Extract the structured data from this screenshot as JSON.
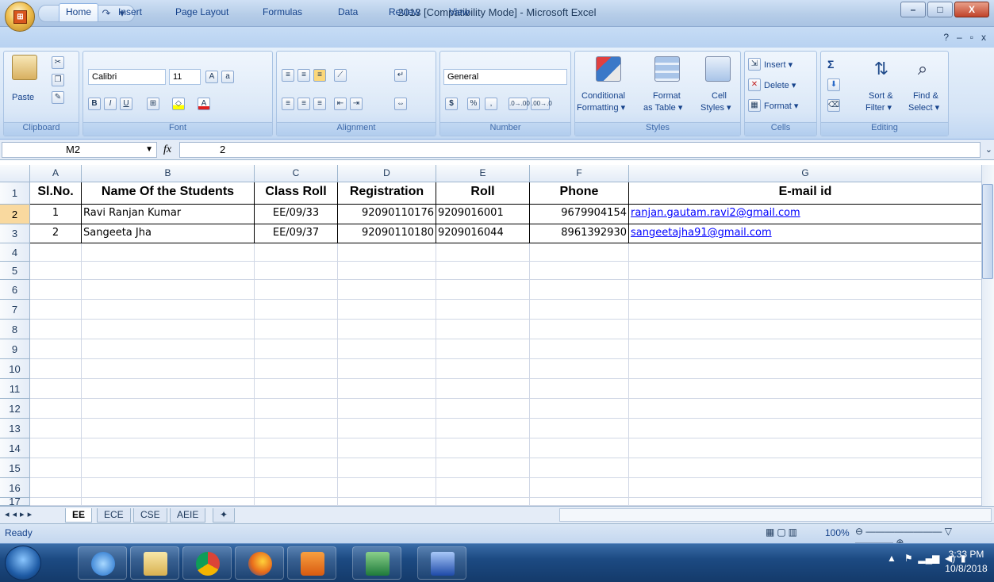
{
  "window": {
    "title": "2013  [Compatibility Mode] - Microsoft Excel",
    "minimize": "–",
    "maximize": "□",
    "close": "X"
  },
  "ribbon_tabs": [
    "Home",
    "Insert",
    "Page Layout",
    "Formulas",
    "Data",
    "Review",
    "View"
  ],
  "active_tab": "Home",
  "ribbon": {
    "clipboard": {
      "label": "Clipboard",
      "paste": "Paste"
    },
    "font": {
      "label": "Font",
      "font_name": "Calibri",
      "font_size": "11",
      "bold": "B",
      "italic": "I",
      "underline": "U"
    },
    "alignment": {
      "label": "Alignment"
    },
    "number": {
      "label": "Number",
      "format": "General",
      "currency": "$",
      "percent": "%",
      "comma": ",",
      "inc_decimal": ".0→.00",
      "dec_decimal": ".00→.0"
    },
    "styles": {
      "label": "Styles",
      "conditional": "Conditional",
      "conditional2": "Formatting ▾",
      "format_table": "Format",
      "format_table2": "as Table ▾",
      "cell_styles": "Cell",
      "cell_styles2": "Styles ▾"
    },
    "cells": {
      "label": "Cells",
      "insert": "Insert ▾",
      "delete": "Delete ▾",
      "format": "Format ▾"
    },
    "editing": {
      "label": "Editing",
      "sigma": "Σ",
      "sort_filter": "Sort &",
      "sort_filter2": "Filter ▾",
      "find_select": "Find &",
      "find_select2": "Select ▾"
    }
  },
  "formula_bar": {
    "name_box": "M2",
    "fx": "fx",
    "value": "2"
  },
  "columns": [
    "A",
    "B",
    "C",
    "D",
    "E",
    "F",
    "G"
  ],
  "rows": [
    "1",
    "2",
    "3",
    "4",
    "5",
    "6",
    "7",
    "8",
    "9",
    "10",
    "11",
    "12",
    "13",
    "14",
    "15",
    "16",
    "17"
  ],
  "table": {
    "headers": [
      "Sl.No.",
      "Name Of the Students",
      "Class Roll",
      "Registration",
      "Roll",
      "Phone",
      "E-mail id"
    ],
    "records": [
      [
        "1",
        "Ravi Ranjan Kumar",
        "EE/09/33",
        "92090110176",
        "9209016001",
        "9679904154",
        "ranjan.gautam.ravi2@gmail.com"
      ],
      [
        "2",
        "Sangeeta Jha",
        "EE/09/37",
        "92090110180",
        "9209016044",
        "8961392930",
        "sangeetajha91@gmail.com"
      ]
    ]
  },
  "sheet_tabs": [
    "EE",
    "ECE",
    "CSE",
    "AEIE"
  ],
  "active_sheet": "EE",
  "status": {
    "ready": "Ready",
    "zoom": "100%"
  },
  "taskbar": {
    "time": "3:33 PM",
    "date": "10/8/2018"
  }
}
